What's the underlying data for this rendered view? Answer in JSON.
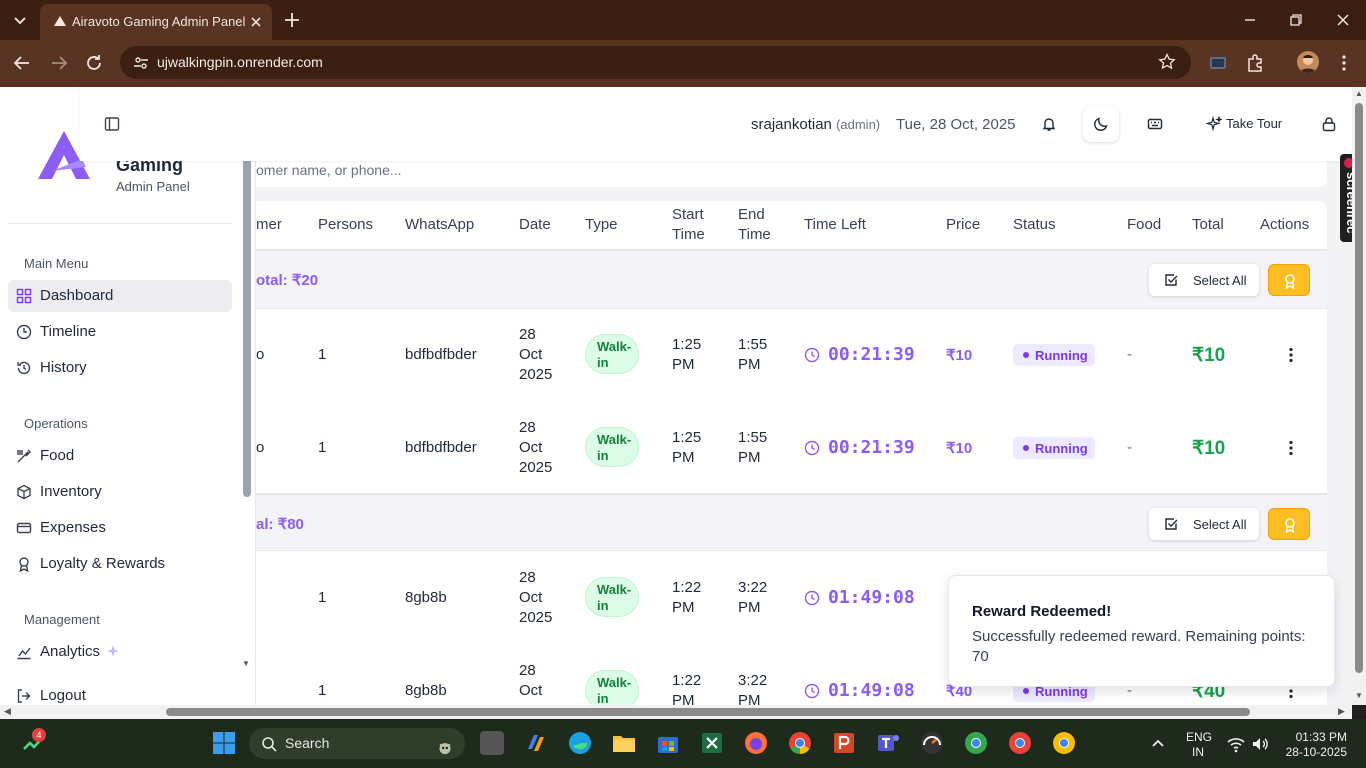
{
  "browser": {
    "tab_title": "Airavoto Gaming Admin Panel",
    "url": "ujwalkingpin.onrender.com"
  },
  "sidebar": {
    "brand": "Gaming",
    "subtitle": "Admin Panel",
    "sections": {
      "main": "Main Menu",
      "operations": "Operations",
      "management": "Management"
    },
    "items": [
      {
        "label": "Dashboard",
        "icon": "dashboard-icon"
      },
      {
        "label": "Timeline",
        "icon": "timeline-icon"
      },
      {
        "label": "History",
        "icon": "history-icon"
      },
      {
        "label": "Food",
        "icon": "food-icon"
      },
      {
        "label": "Inventory",
        "icon": "inventory-icon"
      },
      {
        "label": "Expenses",
        "icon": "expenses-icon"
      },
      {
        "label": "Loyalty & Rewards",
        "icon": "award-icon"
      },
      {
        "label": "Analytics",
        "icon": "analytics-icon"
      },
      {
        "label": "Logout",
        "icon": "logout-icon"
      }
    ]
  },
  "header": {
    "username": "srajankotian",
    "role": "(admin)",
    "date": "Tue, 28 Oct, 2025",
    "tour_label": "Take Tour"
  },
  "search": {
    "placeholder_fragment": "omer name, or phone..."
  },
  "table": {
    "columns": [
      "mer",
      "Persons",
      "WhatsApp",
      "Date",
      "Type",
      "Start Time",
      "End Time",
      "Time Left",
      "Price",
      "Status",
      "Food",
      "Total",
      "Actions"
    ],
    "select_all_label": "Select All",
    "groups": [
      {
        "total_label": "otal: ₹20",
        "rows": [
          {
            "customer": "o",
            "persons": "1",
            "whatsapp": "bdfbdfbder",
            "date": "28 Oct 2025",
            "type": "Walk-in",
            "start": "1:25 PM",
            "end": "1:55 PM",
            "time_left": "00:21:39",
            "price": "₹10",
            "status": "Running",
            "food": "-",
            "total": "₹10"
          },
          {
            "customer": "o",
            "persons": "1",
            "whatsapp": "bdfbdfbder",
            "date": "28 Oct 2025",
            "type": "Walk-in",
            "start": "1:25 PM",
            "end": "1:55 PM",
            "time_left": "00:21:39",
            "price": "₹10",
            "status": "Running",
            "food": "-",
            "total": "₹10"
          }
        ]
      },
      {
        "total_label": "al: ₹80",
        "rows": [
          {
            "customer": "",
            "persons": "1",
            "whatsapp": "8gb8b",
            "date": "28 Oct 2025",
            "type": "Walk-in",
            "start": "1:22 PM",
            "end": "3:22 PM",
            "time_left": "01:49:08",
            "price": "",
            "status": "",
            "food": "",
            "total": ""
          },
          {
            "customer": "",
            "persons": "1",
            "whatsapp": "8gb8b",
            "date": "28 Oct",
            "type": "Walk-in",
            "start": "1:22 PM",
            "end": "3:22 PM",
            "time_left": "01:49:08",
            "price": "₹40",
            "status": "Running",
            "food": "-",
            "total": "₹40"
          }
        ]
      }
    ]
  },
  "toast": {
    "title": "Reward Redeemed!",
    "description": "Successfully redeemed reward. Remaining points: 70"
  },
  "overlay": {
    "screenrec": "screenrec"
  },
  "taskbar": {
    "search_label": "Search",
    "badge_count": "4",
    "lang_line1": "ENG",
    "lang_line2": "IN",
    "time": "01:33 PM",
    "date": "28-10-2025"
  },
  "colors": {
    "accent": "#8b5cf6",
    "success": "#16a34a",
    "warning": "#fbbf24",
    "browser_frame": "#5a3422"
  }
}
